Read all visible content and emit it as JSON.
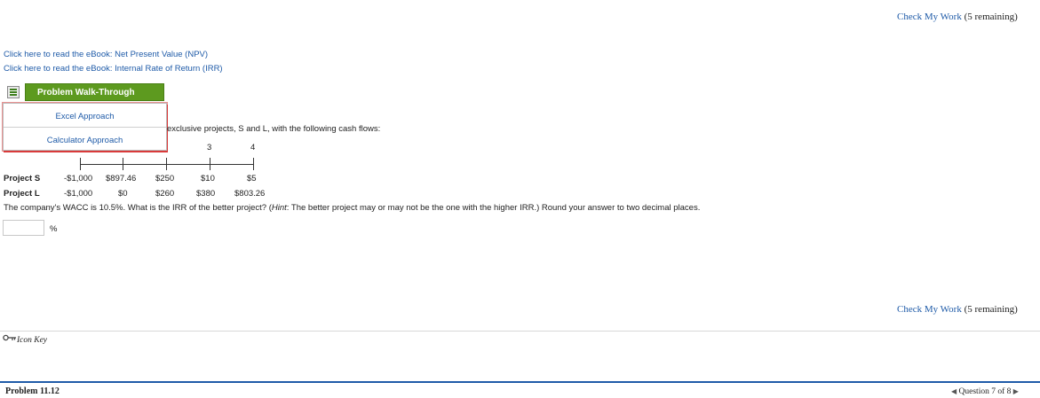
{
  "check_work": {
    "label": "Check My Work",
    "remaining": "(5 remaining)"
  },
  "ebooks": [
    {
      "label": "Click here to read the eBook: Net Present Value (NPV)"
    },
    {
      "label": "Click here to read the eBook: Internal Rate of Return (IRR)"
    }
  ],
  "walkthrough": {
    "label": "Problem Walk-Through",
    "icon": "film-strip-icon",
    "menu": [
      "Excel Approach",
      "Calculator Approach"
    ]
  },
  "problem": {
    "intro_visible": "exclusive projects, S and L, with the following cash flows:",
    "timeline_labels": [
      "3",
      "4"
    ],
    "rows": [
      {
        "label": "Project S",
        "values": [
          "-$1,000",
          "$897.46",
          "$250",
          "$10",
          "$5"
        ]
      },
      {
        "label": "Project L",
        "values": [
          "-$1,000",
          "$0",
          "$260",
          "$380",
          "$803.26"
        ]
      }
    ],
    "question_before_hint": "The company's WACC is 10.5%. What is the IRR of the better project? (",
    "hint_label": "Hint",
    "question_after_hint": ": The better project may or may not be the one with the higher IRR.) Round your answer to two decimal places.",
    "answer_value": "",
    "unit": "%"
  },
  "footer": {
    "icon_key_label": "Icon Key",
    "icon_key_icon": "key-icon",
    "problem_label": "Problem 11.12",
    "question_nav": "Question 7 of 8"
  }
}
